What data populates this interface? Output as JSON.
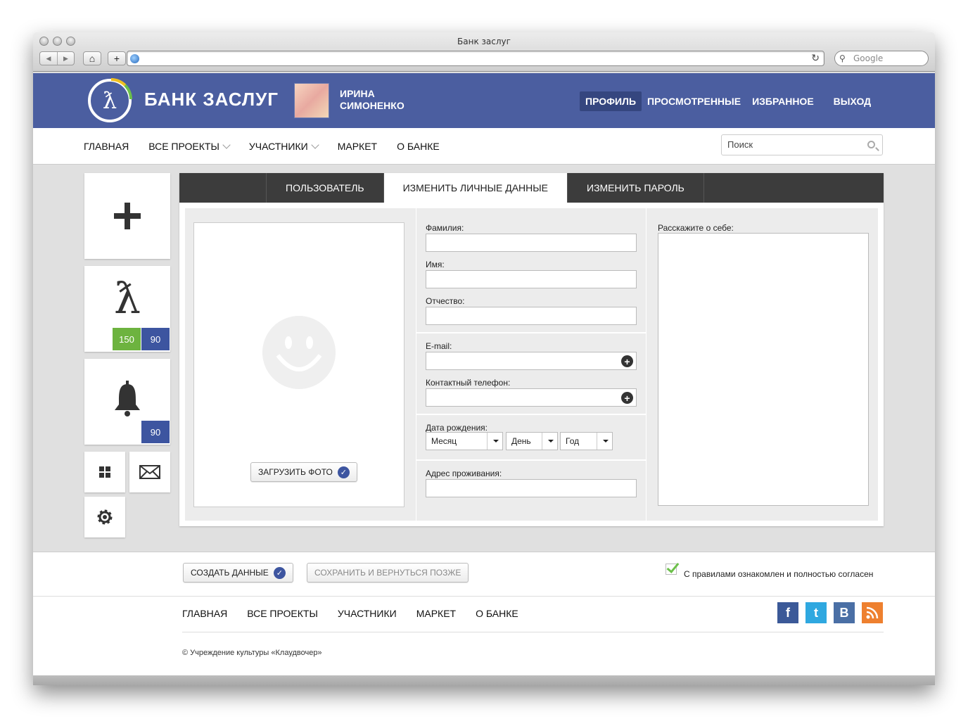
{
  "window": {
    "title": "Банк заслуг",
    "search_placeholder": "Google"
  },
  "header": {
    "brand": "БАНК ЗАСЛУГ",
    "logo_glyph": "ƛ",
    "user_first": "ИРИНА",
    "user_last": "СИМОНЕНКО",
    "nav": [
      "ПРОФИЛЬ",
      "ПРОСМОТРЕННЫЕ",
      "ИЗБРАННОЕ",
      "ВЫХОД"
    ],
    "active_nav": "ПРОФИЛЬ",
    "color": "#4b5ea0"
  },
  "main_nav": {
    "items": [
      "ГЛАВНАЯ",
      "ВСЕ ПРОЕКТЫ",
      "УЧАСТНИКИ",
      "МАРКЕТ",
      "О БАНКЕ"
    ],
    "search_placeholder": "Поиск"
  },
  "sidebar": {
    "merit_green": "150",
    "merit_blue": "90",
    "notifications": "90",
    "green_color": "#6db33f",
    "blue_color": "#3d55a0"
  },
  "tabs": [
    "ПОЛЬЗОВАТЕЛЬ",
    "ИЗМЕНИТЬ ЛИЧНЫЕ ДАННЫЕ",
    "ИЗМЕНИТЬ ПАРОЛЬ"
  ],
  "active_tab": "ИЗМЕНИТЬ ЛИЧНЫЕ ДАННЫЕ",
  "form": {
    "upload_photo": "ЗАГРУЗИТЬ ФОТО",
    "surname": "Фамилия:",
    "name": "Имя:",
    "patronymic": "Отчество:",
    "email": "E-mail:",
    "phone": "Контактный телефон:",
    "birthdate": "Дата рождения:",
    "month": "Месяц",
    "day": "День",
    "year": "Год",
    "address": "Адрес проживания:",
    "about": "Расскажите о себе:"
  },
  "actions": {
    "create": "СОЗДАТЬ ДАННЫЕ",
    "save_later": "СОХРАНИТЬ И ВЕРНУТЬСЯ ПОЗЖЕ",
    "agree": "С правилами ознакомлен и полностью согласен",
    "agree_checked": true
  },
  "footer": {
    "nav": [
      "ГЛАВНАЯ",
      "ВСЕ ПРОЕКТЫ",
      "УЧАСТНИКИ",
      "МАРКЕТ",
      "О БАНКЕ"
    ],
    "copyright": "© Учреждение культуры «Клаудвочер»",
    "social": [
      {
        "name": "facebook-icon",
        "glyph": "f",
        "color": "#3b5998"
      },
      {
        "name": "twitter-icon",
        "glyph": "t",
        "color": "#2fa8e0"
      },
      {
        "name": "vkontakte-icon",
        "glyph": "B",
        "color": "#4a6fa5"
      },
      {
        "name": "rss-icon",
        "glyph": "◣",
        "color": "#ee802f"
      }
    ]
  }
}
